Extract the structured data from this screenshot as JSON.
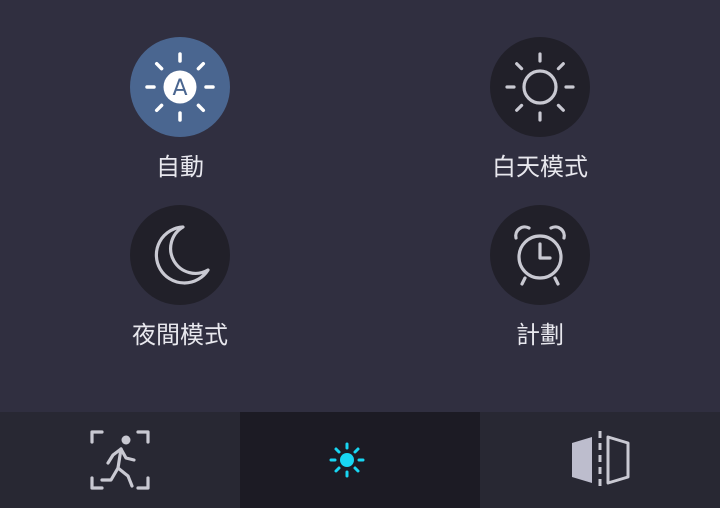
{
  "modes": {
    "auto": {
      "label": "自動",
      "icon": "auto-brightness-icon",
      "selected": true
    },
    "day": {
      "label": "白天模式",
      "icon": "sun-icon",
      "selected": false
    },
    "night": {
      "label": "夜間模式",
      "icon": "moon-icon",
      "selected": false
    },
    "schedule": {
      "label": "計劃",
      "icon": "alarm-clock-icon",
      "selected": false
    }
  },
  "auto_icon_letter": "A",
  "bottom_tabs": [
    {
      "icon": "exit-icon",
      "active": false
    },
    {
      "icon": "day-night-icon",
      "active": true
    },
    {
      "icon": "page-layout-icon",
      "active": false
    }
  ],
  "colors": {
    "panel_background": "#302f40",
    "circle_background": "#212029",
    "selected_circle": "#4a6690",
    "bottom_bar": "#282833",
    "bottom_active_tab": "#1c1b24",
    "accent_cyan": "#18d6f2",
    "label_text": "#e8e8ee"
  }
}
